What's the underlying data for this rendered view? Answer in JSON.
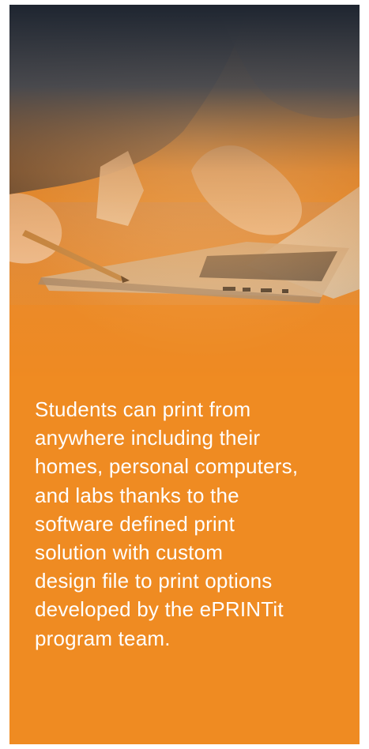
{
  "hero": {
    "image": "laptop-desk-photo",
    "overlay_color": "#ef8b22"
  },
  "caption": {
    "text": "Students can print from\nanywhere including their\nhomes, personal computers,\nand labs thanks to the\nsoftware defined print\nsolution with custom\ndesign file to print options\ndeveloped by the ePRINTit\nprogram team."
  }
}
